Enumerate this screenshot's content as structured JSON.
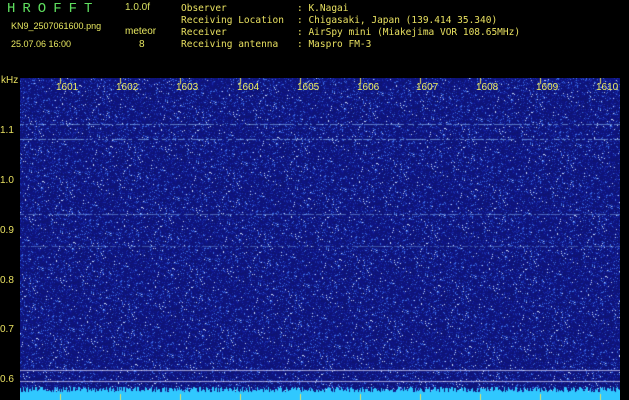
{
  "header": {
    "app_title": "HROFFT",
    "version": "1.0.0f",
    "filename": "KN9_2507061600.png",
    "mode": "meteor",
    "datetime": "25.07.06 16:00",
    "count": "8"
  },
  "info": [
    {
      "label": "Observer",
      "value": ": K.Nagai"
    },
    {
      "label": "Receiving Location",
      "value": ": Chigasaki, Japan (139.414 35.340)"
    },
    {
      "label": "Receiver",
      "value": ": AirSpy mini (Miakejima VOR 108.65MHz)"
    },
    {
      "label": "Receiving antenna",
      "value": ": Maspro FM-3"
    }
  ],
  "axis": {
    "y_unit": "kHz",
    "x_ticks": [
      "1601",
      "1602",
      "1603",
      "1604",
      "1605",
      "1606",
      "1607",
      "1608",
      "1609",
      "1610"
    ],
    "y_ticks": [
      "1.1",
      "1.0",
      "0.9",
      "0.8",
      "0.7",
      "0.6"
    ]
  },
  "colors": {
    "background": "#000000",
    "plot": "#121a78",
    "label": "#e8e060",
    "title": "#5fe05f",
    "baseline": "#30c8ff"
  }
}
